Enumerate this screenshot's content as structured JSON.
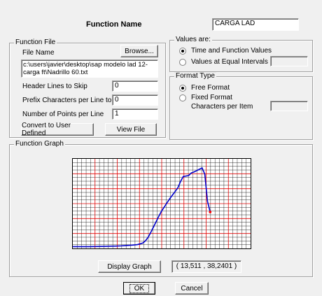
{
  "header": {
    "title": "Function Name",
    "function_name_value": "CARGA LAD"
  },
  "function_file": {
    "legend": "Function File",
    "file_name_label": "File Name",
    "browse_label": "Browse...",
    "file_path": "c:\\users\\javier\\desktop\\sap modelo lad 12- carga ft\\Nadrillo 60.txt",
    "header_lines_label": "Header Lines to Skip",
    "header_lines_value": "0",
    "prefix_chars_label": "Prefix Characters per Line to Skip",
    "prefix_chars_value": "0",
    "points_per_line_label": "Number of Points per Line",
    "points_per_line_value": "1",
    "convert_label": "Convert to User Defined",
    "view_file_label": "View File"
  },
  "values_are": {
    "legend": "Values are:",
    "option_time": "Time and Function Values",
    "option_equal": "Values at Equal Intervals of",
    "equal_interval_value": ""
  },
  "format_type": {
    "legend": "Format Type",
    "option_free": "Free Format",
    "option_fixed": "Fixed Format",
    "chars_per_item_label": "Characters per Item",
    "chars_per_item_value": ""
  },
  "function_graph": {
    "legend": "Function Graph",
    "display_graph_label": "Display Graph",
    "coord_readout": "( 13,511 , 38,2401 )"
  },
  "footer": {
    "ok_label": "OK",
    "cancel_label": "Cancel"
  },
  "colors": {
    "curve": "#0000cc",
    "grid_minor": "#000000",
    "grid_major": "#e00000",
    "marker": "#ff0000"
  },
  "chart_data": {
    "type": "line",
    "x": [
      0,
      1,
      2,
      3,
      4,
      5,
      6,
      7,
      8,
      9,
      10,
      11,
      12,
      13,
      13.5,
      14,
      14.5,
      15,
      15.5,
      16,
      16.5,
      17,
      17.5,
      18,
      18.5,
      19,
      19.5,
      20,
      20.5,
      21,
      21.5,
      22,
      22.5,
      23,
      23.5,
      24,
      24.5,
      25,
      25.5
    ],
    "y": [
      0,
      0,
      0,
      0,
      0.1,
      0.2,
      0.3,
      0.5,
      0.6,
      0.8,
      1.2,
      1.6,
      2.2,
      4.0,
      6.5,
      10.5,
      16,
      22,
      28,
      34,
      39.5,
      44,
      48.5,
      53,
      57,
      61,
      65,
      72,
      77.5,
      78,
      78.5,
      81.5,
      82.5,
      84,
      85.5,
      87,
      80,
      50,
      38.24
    ],
    "marker": {
      "x": 25.5,
      "y": 38.24
    },
    "xlim": [
      0,
      33
    ],
    "ylim": [
      -2,
      97
    ],
    "grid": true,
    "axis_labels_visible": false
  }
}
